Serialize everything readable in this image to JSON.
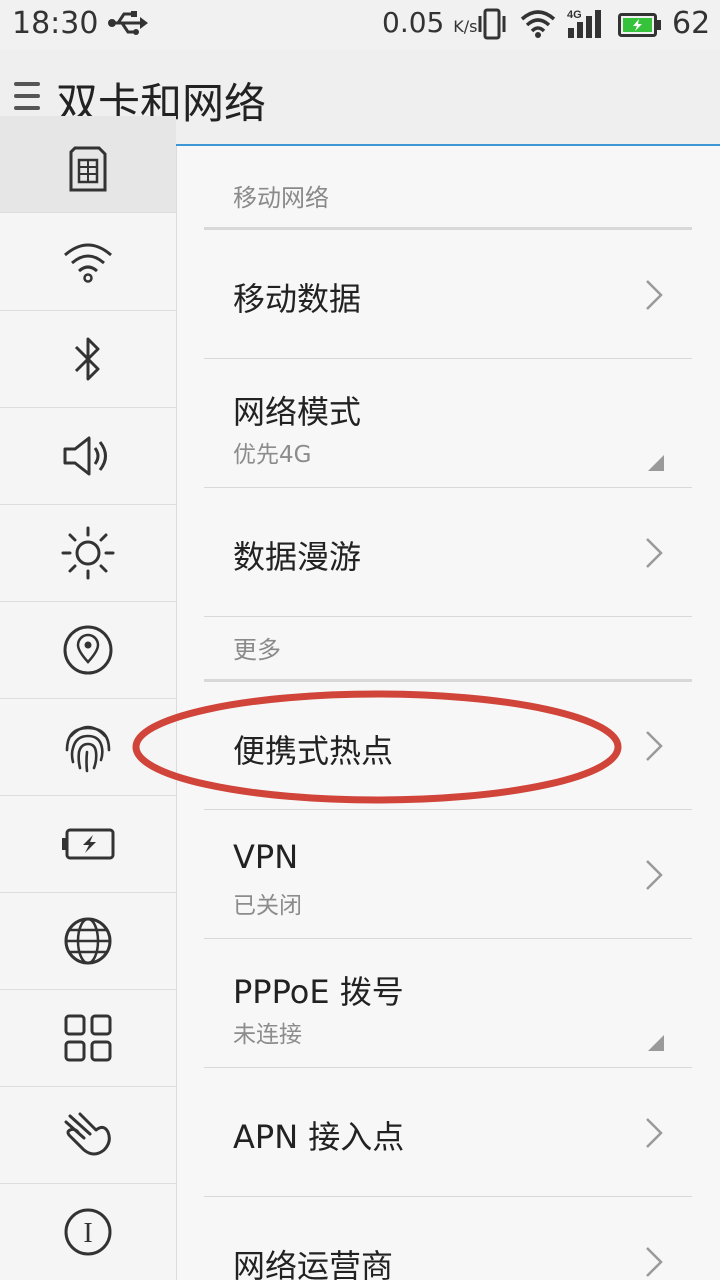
{
  "status_bar": {
    "time": "18:30",
    "network_speed": "0.05",
    "speed_unit": "K/s",
    "battery_level": "62",
    "icons": [
      "usb-icon",
      "vibrate-icon",
      "wifi-icon",
      "signal-4g-icon",
      "battery-icon"
    ],
    "battery_color": "#36c23a"
  },
  "header": {
    "title": "双卡和网络",
    "accent_color": "#3d96d6"
  },
  "sidebar": {
    "items": [
      {
        "name": "sim-icon",
        "active": true
      },
      {
        "name": "wifi-icon"
      },
      {
        "name": "bluetooth-icon"
      },
      {
        "name": "sound-icon"
      },
      {
        "name": "brightness-icon"
      },
      {
        "name": "location-icon"
      },
      {
        "name": "fingerprint-icon"
      },
      {
        "name": "battery-icon"
      },
      {
        "name": "globe-icon"
      },
      {
        "name": "apps-icon"
      },
      {
        "name": "gesture-icon"
      },
      {
        "name": "about-icon"
      }
    ]
  },
  "main": {
    "sections": [
      {
        "header": "移动网络",
        "rows": [
          {
            "title": "移动数据",
            "indicator": "chevron"
          },
          {
            "title": "网络模式",
            "subtitle": "优先4G",
            "indicator": "dropdown"
          },
          {
            "title": "数据漫游",
            "indicator": "chevron"
          }
        ]
      },
      {
        "header": "更多",
        "rows": [
          {
            "title": "便携式热点",
            "indicator": "chevron",
            "highlighted": true
          },
          {
            "title": "VPN",
            "subtitle": "已关闭",
            "indicator": "chevron"
          },
          {
            "title": "PPPoE 拨号",
            "subtitle": "未连接",
            "indicator": "dropdown"
          },
          {
            "title": "APN 接入点",
            "indicator": "chevron"
          },
          {
            "title": "网络运营商",
            "indicator": "chevron"
          }
        ]
      }
    ],
    "highlight_color": "#d0443a"
  }
}
